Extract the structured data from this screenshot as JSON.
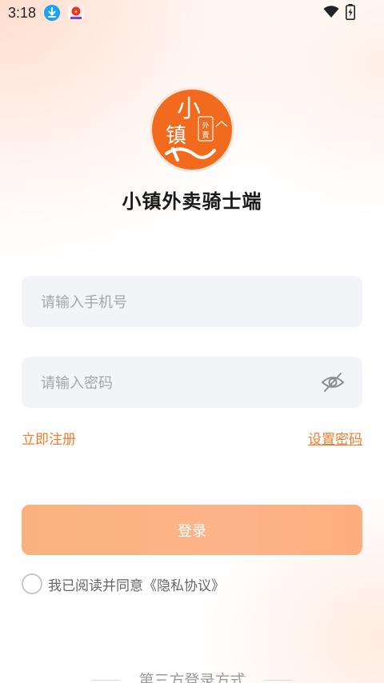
{
  "status_bar": {
    "time": "3:18",
    "icons": [
      "download-icon",
      "app-badge-icon",
      "wifi-icon",
      "battery-charging-icon"
    ]
  },
  "logo": {
    "icon": "xiaozhen-waimai-logo",
    "colors": {
      "circle": "#f26a1d",
      "ink": "#ffffff"
    }
  },
  "app_title": "小镇外卖骑士端",
  "phone_input": {
    "placeholder": "请输入手机号",
    "value": ""
  },
  "password_input": {
    "placeholder": "请输入密码",
    "value": "",
    "toggle_icon": "eye-off-icon"
  },
  "links": {
    "register": "立即注册",
    "reset_password": "设置密码"
  },
  "login_button": "登录",
  "agreement": {
    "checked": false,
    "prefix": "我已阅读并同意",
    "link": "《隐私协议》"
  },
  "third_party_label": "第三方登录方式",
  "colors": {
    "accent": "#f07b2e",
    "button": "#fdb489",
    "input_bg": "#f3f4f7"
  }
}
